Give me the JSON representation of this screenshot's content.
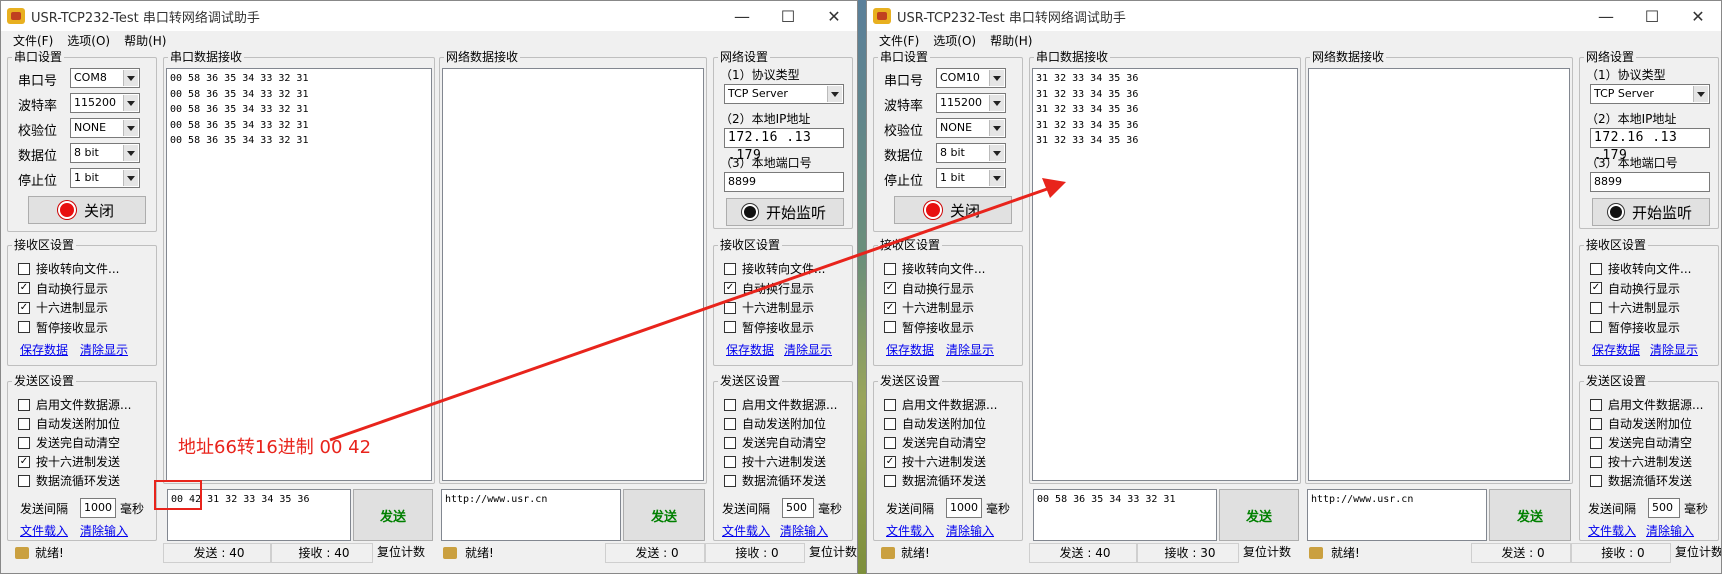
{
  "windows": [
    {
      "id": "left",
      "title": "USR-TCP232-Test 串口转网络调试助手",
      "menu": [
        "文件(F)",
        "选项(O)",
        "帮助(H)"
      ],
      "serial": {
        "legend": "串口设置",
        "port_label": "串口号",
        "port": "COM8",
        "baud_label": "波特率",
        "baud": "115200",
        "parity_label": "校验位",
        "parity": "NONE",
        "databits_label": "数据位",
        "databits": "8 bit",
        "stopbits_label": "停止位",
        "stopbits": "1 bit",
        "open_button": "关闭"
      },
      "serial_recv": {
        "legend": "串口数据接收",
        "text": "00 58 36 35 34 33 32 31\n00 58 36 35 34 33 32 31\n00 58 36 35 34 33 32 31\n00 58 36 35 34 33 32 31\n00 58 36 35 34 33 32 31"
      },
      "net_recv": {
        "legend": "网络数据接收",
        "text": ""
      },
      "recv_settings": {
        "legend": "接收区设置",
        "options": [
          {
            "label": "接收转向文件...",
            "checked": false
          },
          {
            "label": "自动换行显示",
            "checked": true
          },
          {
            "label": "十六进制显示",
            "checked": true
          },
          {
            "label": "暂停接收显示",
            "checked": false
          }
        ],
        "save": "保存数据",
        "clear": "清除显示"
      },
      "send_settings": {
        "legend": "发送区设置",
        "options": [
          {
            "label": "启用文件数据源...",
            "checked": false
          },
          {
            "label": "自动发送附加位",
            "checked": false
          },
          {
            "label": "发送完自动清空",
            "checked": false
          },
          {
            "label": "按十六进制发送",
            "checked": true
          },
          {
            "label": "数据流循环发送",
            "checked": false
          }
        ],
        "interval_label": "发送间隔",
        "interval": "1000",
        "interval_unit": "毫秒",
        "load_file": "文件载入",
        "clear_input": "清除输入"
      },
      "serial_send_text": "00 42 31 32 33 34 35 36",
      "net_send_text": "http://www.usr.cn",
      "send_button": "发送",
      "net_send_button": "发送",
      "net": {
        "legend": "网络设置",
        "protocol_label": "（1）协议类型",
        "protocol": "TCP Server",
        "ip_label": "（2）本地IP地址",
        "ip": "172.16 .13 .179",
        "port_label": "（3）本地端口号",
        "port": "8899",
        "listen_button": "开始监听"
      },
      "net_recv_settings": {
        "legend": "接收区设置",
        "options": [
          {
            "label": "接收转向文件...",
            "checked": false
          },
          {
            "label": "自动换行显示",
            "checked": true
          },
          {
            "label": "十六进制显示",
            "checked": false
          },
          {
            "label": "暂停接收显示",
            "checked": false
          }
        ],
        "save": "保存数据",
        "clear": "清除显示"
      },
      "net_send_settings": {
        "legend": "发送区设置",
        "options": [
          {
            "label": "启用文件数据源...",
            "checked": false
          },
          {
            "label": "自动发送附加位",
            "checked": false
          },
          {
            "label": "发送完自动清空",
            "checked": false
          },
          {
            "label": "按十六进制发送",
            "checked": false
          },
          {
            "label": "数据流循环发送",
            "checked": false
          }
        ],
        "interval_label": "发送间隔",
        "interval": "500",
        "interval_unit": "毫秒",
        "load_file": "文件载入",
        "clear_input": "清除输入"
      },
      "status": {
        "ready": "就绪!",
        "sent1": "发送 : 40",
        "recv1": "接收 : 40",
        "reset1": "复位计数",
        "ready2": "就绪!",
        "sent2": "发送 : 0",
        "recv2": "接收 : 0",
        "reset2": "复位计数"
      }
    },
    {
      "id": "right",
      "title": "USR-TCP232-Test 串口转网络调试助手",
      "menu": [
        "文件(F)",
        "选项(O)",
        "帮助(H)"
      ],
      "serial": {
        "legend": "串口设置",
        "port_label": "串口号",
        "port": "COM10",
        "baud_label": "波特率",
        "baud": "115200",
        "parity_label": "校验位",
        "parity": "NONE",
        "databits_label": "数据位",
        "databits": "8 bit",
        "stopbits_label": "停止位",
        "stopbits": "1 bit",
        "open_button": "关闭"
      },
      "serial_recv": {
        "legend": "串口数据接收",
        "text": "31 32 33 34 35 36\n31 32 33 34 35 36\n31 32 33 34 35 36\n31 32 33 34 35 36\n31 32 33 34 35 36"
      },
      "net_recv": {
        "legend": "网络数据接收",
        "text": ""
      },
      "recv_settings": {
        "legend": "接收区设置",
        "options": [
          {
            "label": "接收转向文件...",
            "checked": false
          },
          {
            "label": "自动换行显示",
            "checked": true
          },
          {
            "label": "十六进制显示",
            "checked": true
          },
          {
            "label": "暂停接收显示",
            "checked": false
          }
        ],
        "save": "保存数据",
        "clear": "清除显示"
      },
      "send_settings": {
        "legend": "发送区设置",
        "options": [
          {
            "label": "启用文件数据源...",
            "checked": false
          },
          {
            "label": "自动发送附加位",
            "checked": false
          },
          {
            "label": "发送完自动清空",
            "checked": false
          },
          {
            "label": "按十六进制发送",
            "checked": true
          },
          {
            "label": "数据流循环发送",
            "checked": false
          }
        ],
        "interval_label": "发送间隔",
        "interval": "1000",
        "interval_unit": "毫秒",
        "load_file": "文件载入",
        "clear_input": "清除输入"
      },
      "serial_send_text": "00 58 36 35 34 33 32 31",
      "net_send_text": "http://www.usr.cn",
      "send_button": "发送",
      "net_send_button": "发送",
      "net": {
        "legend": "网络设置",
        "protocol_label": "（1）协议类型",
        "protocol": "TCP Server",
        "ip_label": "（2）本地IP地址",
        "ip": "172.16 .13 .179",
        "port_label": "（3）本地端口号",
        "port": "8899",
        "listen_button": "开始监听"
      },
      "net_recv_settings": {
        "legend": "接收区设置",
        "options": [
          {
            "label": "接收转向文件...",
            "checked": false
          },
          {
            "label": "自动换行显示",
            "checked": true
          },
          {
            "label": "十六进制显示",
            "checked": false
          },
          {
            "label": "暂停接收显示",
            "checked": false
          }
        ],
        "save": "保存数据",
        "clear": "清除显示"
      },
      "net_send_settings": {
        "legend": "发送区设置",
        "options": [
          {
            "label": "启用文件数据源...",
            "checked": false
          },
          {
            "label": "自动发送附加位",
            "checked": false
          },
          {
            "label": "发送完自动清空",
            "checked": false
          },
          {
            "label": "按十六进制发送",
            "checked": false
          },
          {
            "label": "数据流循环发送",
            "checked": false
          }
        ],
        "interval_label": "发送间隔",
        "interval": "500",
        "interval_unit": "毫秒",
        "load_file": "文件载入",
        "clear_input": "清除输入"
      },
      "status": {
        "ready": "就绪!",
        "sent1": "发送 : 40",
        "recv1": "接收 : 30",
        "reset1": "复位计数",
        "ready2": "就绪!",
        "sent2": "发送 : 0",
        "recv2": "接收 : 0",
        "reset2": "复位计数"
      }
    }
  ],
  "annotation": {
    "text": "地址66转16进制 00 42",
    "color": "#e8241c"
  }
}
